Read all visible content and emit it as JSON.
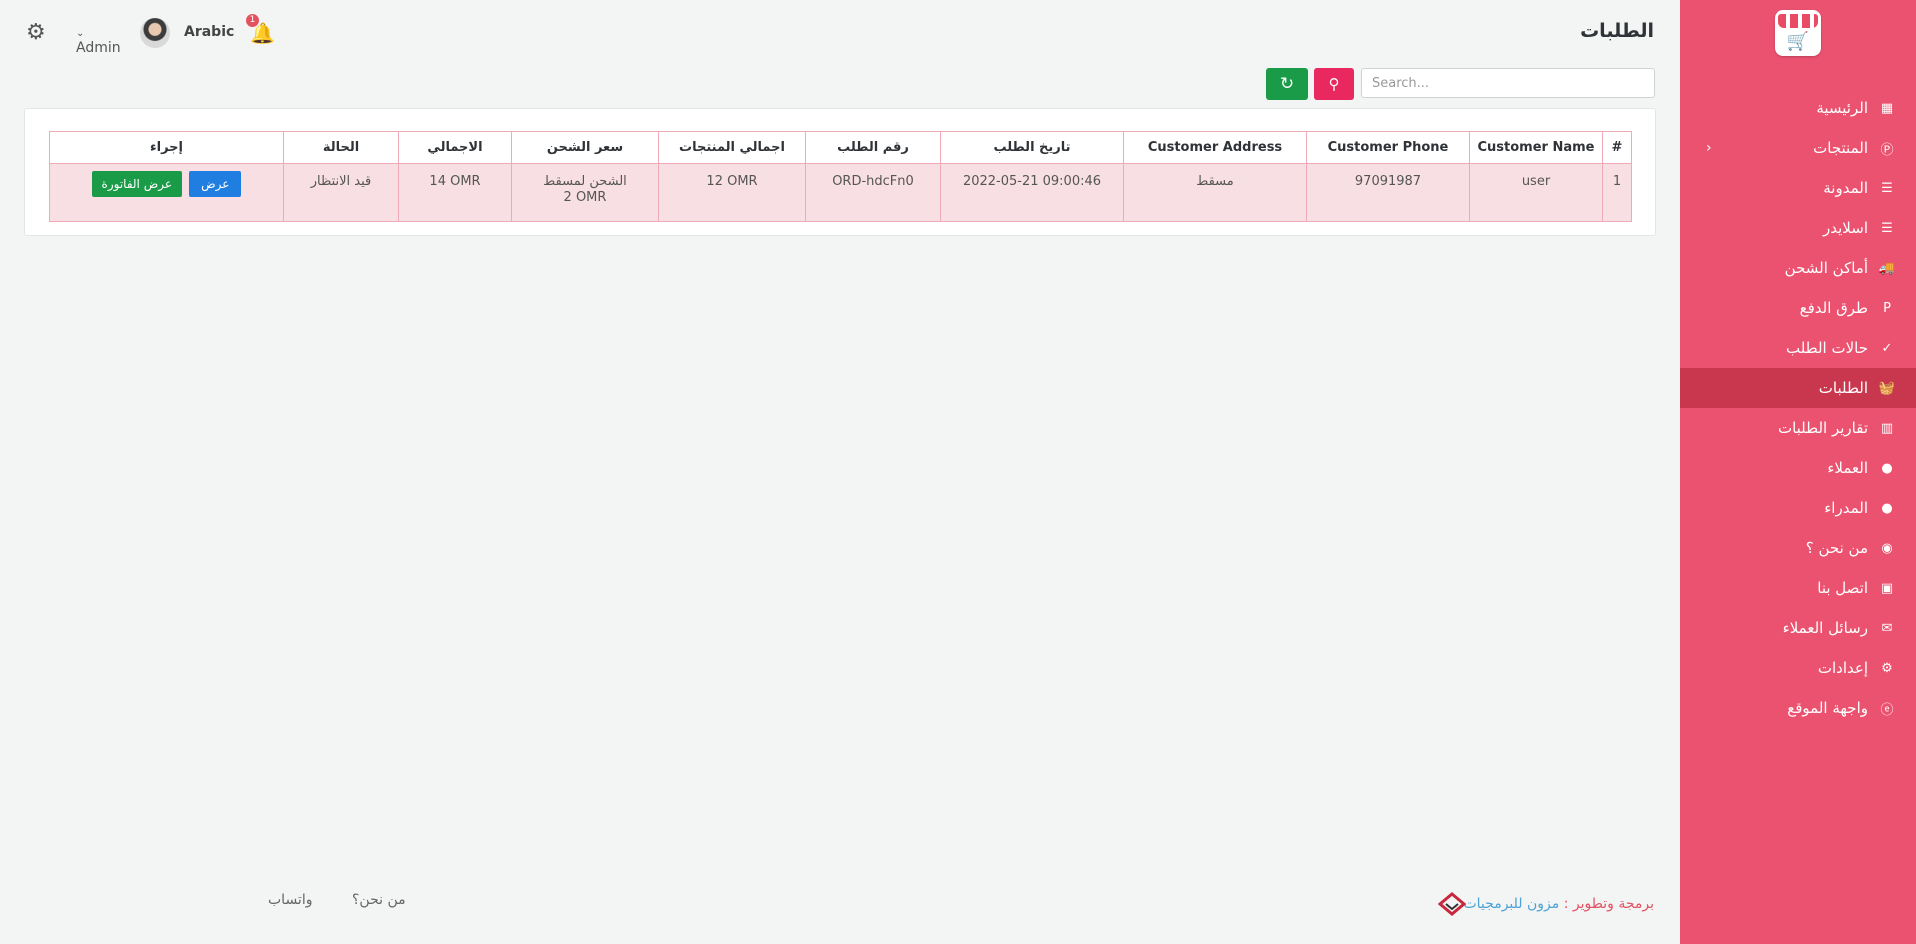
{
  "page": {
    "title": "الطلبات"
  },
  "topbar": {
    "language": "Arabic",
    "user": "Admin",
    "notifications": "1"
  },
  "search": {
    "placeholder": "Search..."
  },
  "sidebar": {
    "items": [
      {
        "label": "الرئيسية",
        "icon": "dashboard-icon"
      },
      {
        "label": "المنتجات",
        "icon": "product-icon"
      },
      {
        "label": "المدونة",
        "icon": "blog-icon"
      },
      {
        "label": "اسلايدر",
        "icon": "slider-icon"
      },
      {
        "label": "أماكن الشحن",
        "icon": "truck-icon"
      },
      {
        "label": "طرق الدفع",
        "icon": "paypal-icon"
      },
      {
        "label": "حالات الطلب",
        "icon": "check-circle-icon"
      },
      {
        "label": "الطلبات",
        "icon": "basket-icon"
      },
      {
        "label": "تقارير الطلبات",
        "icon": "chart-icon"
      },
      {
        "label": "العملاء",
        "icon": "user-icon"
      },
      {
        "label": "المدراء",
        "icon": "user-icon"
      },
      {
        "label": "من نحن ؟",
        "icon": "eye-icon"
      },
      {
        "label": "اتصل بنا",
        "icon": "contact-card-icon"
      },
      {
        "label": "رسائل العملاء",
        "icon": "envelope-icon"
      },
      {
        "label": "إعدادات",
        "icon": "gear-icon"
      },
      {
        "label": "واجهة الموقع",
        "icon": "browser-icon"
      }
    ]
  },
  "table": {
    "headers": [
      "#",
      "Customer Name",
      "Customer Phone",
      "Customer Address",
      "تاريخ الطلب",
      "رقم الطلب",
      "اجمالي المنتجات",
      "سعر الشحن",
      "الاجمالي",
      "الحالة",
      "إجراء"
    ],
    "rows": [
      {
        "num": "1",
        "name": "user",
        "phone": "97091987",
        "address": "مسقط",
        "date": "2022-05-21 09:00:46",
        "order_id": "ORD-hdcFn0",
        "products_total": "12 OMR",
        "shipping_name": "الشحن لمسقط",
        "shipping_price": "2 OMR",
        "total": "14 OMR",
        "status": "قيد الانتظار",
        "view_label": "عرض",
        "invoice_label": "عرض الفاتورة"
      }
    ]
  },
  "footer": {
    "credit_prefix": "برمجة وتطوير :",
    "credit_company": "مزون للبرمجيات",
    "links": [
      "من نحن؟",
      "واتساب"
    ]
  },
  "colors": {
    "sidebar": "#ea526f",
    "sidebar_active": "#c9374f",
    "search_button": "#e8285e",
    "refresh_button": "#1a9b48",
    "view_button": "#1f7ee0"
  }
}
